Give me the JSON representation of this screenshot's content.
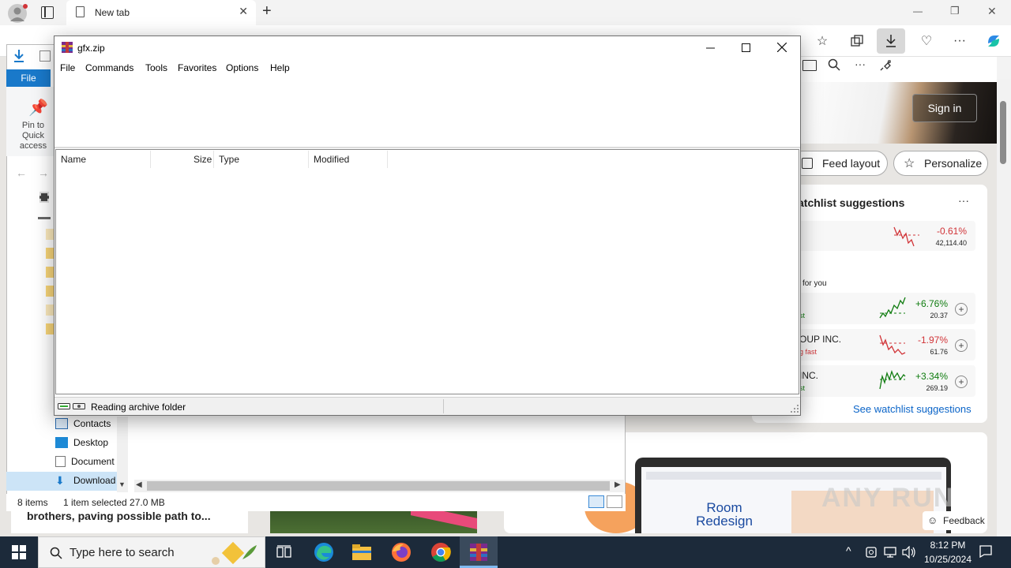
{
  "browser": {
    "tab_title": "New tab",
    "tab_close": "✕",
    "new_tab": "+",
    "win_min": "—",
    "win_restore": "❐",
    "win_close": "✕",
    "more": "···"
  },
  "newtab": {
    "sign_in": "Sign in",
    "feed_layout": "Feed layout",
    "personalize": "Personalize",
    "watchlist_title": "atchlist suggestions",
    "watchlist_more": "···",
    "for_you": "for you",
    "see_watchlist": "See watchlist suggestions",
    "stocks": [
      {
        "name": "",
        "sub": "",
        "pct": "-0.61%",
        "price": "42,114.40",
        "trend": "down",
        "color": "#d13438"
      },
      {
        "name": "",
        "sub": "st",
        "pct": "+6.76%",
        "price": "20.37",
        "trend": "up",
        "color": "#107c10"
      },
      {
        "name": "OUP INC.",
        "sub": "g fast",
        "pct": "-1.97%",
        "price": "61.76",
        "trend": "down",
        "color": "#d13438"
      },
      {
        "name": "INC.",
        "sub": "st",
        "pct": "+3.34%",
        "price": "269.19",
        "trend": "up",
        "color": "#107c10"
      }
    ],
    "news_left": "brothers, paving possible path to...",
    "room_redesign": "Room Redesign",
    "feedback": "Feedback",
    "watermark": "ANY RUN"
  },
  "explorer": {
    "file_tab": "File",
    "pin_label": "Pin to Quick access",
    "nav": [
      {
        "label": "Contacts",
        "icon": "contacts-icon"
      },
      {
        "label": "Desktop",
        "icon": "desktop-icon"
      },
      {
        "label": "Document",
        "icon": "documents-icon"
      },
      {
        "label": "Download",
        "icon": "downloads-icon"
      }
    ],
    "status_items": "8 items",
    "status_selected": "1 item selected  27.0 MB"
  },
  "winrar": {
    "title": "gfx.zip",
    "menu": [
      "File",
      "Commands",
      "Tools",
      "Favorites",
      "Options",
      "Help"
    ],
    "columns": [
      "Name",
      "Size",
      "Type",
      "Modified"
    ],
    "status": "Reading archive folder"
  },
  "taskbar": {
    "search_placeholder": "Type here to search",
    "time": "8:12 PM",
    "date": "10/25/2024",
    "apps": [
      "task-view-icon",
      "edge-icon",
      "file-explorer-icon",
      "firefox-icon",
      "chrome-icon",
      "winrar-icon"
    ]
  },
  "colors": {
    "accent": "#1979ca",
    "taskbar": "#1c2a3a",
    "positive": "#107c10",
    "negative": "#d13438",
    "link": "#0a64c8"
  }
}
